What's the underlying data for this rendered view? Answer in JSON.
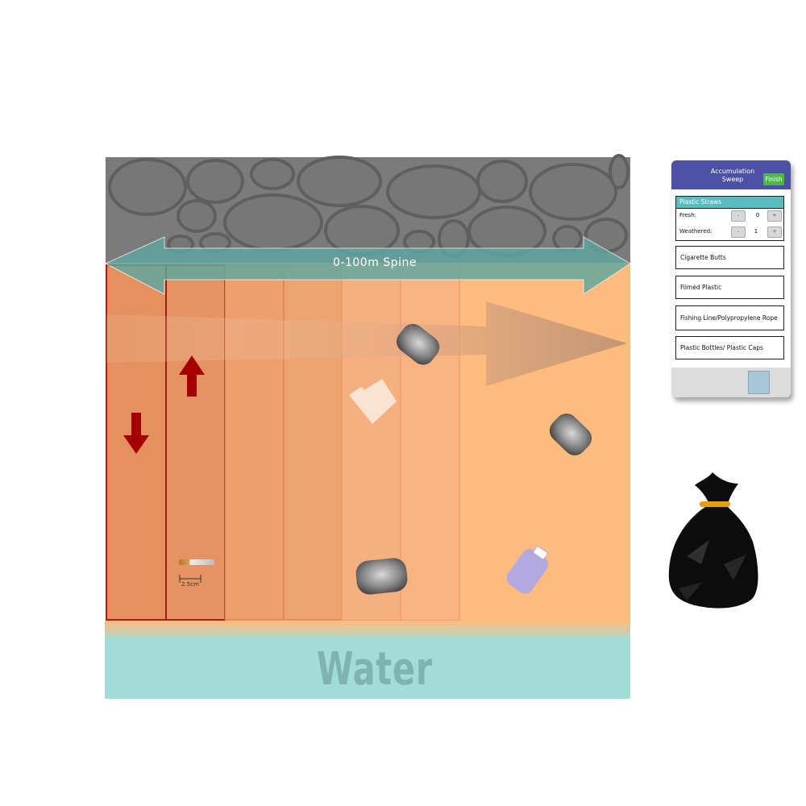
{
  "scene": {
    "spine_label": "0-100m Spine",
    "water_label": "Water",
    "scale_label": "2.5cm",
    "colors": {
      "sand": "#fdbb7d",
      "water": "#a2dcd9",
      "rocks": "#7b7b7b",
      "spine_arrow": "#5ea89f",
      "walk_arrow": "#a50000"
    }
  },
  "panel": {
    "title": "Accumulation Sweep",
    "finish_label": "Finish",
    "active_category": {
      "name": "Plastic Straws",
      "rows": [
        {
          "label": "Fresh:",
          "minus": "-",
          "value": "0",
          "plus": "+"
        },
        {
          "label": "Weathered:",
          "minus": "-",
          "value": "1",
          "plus": "+"
        }
      ]
    },
    "categories": [
      "Cigarette Butts",
      "Filmed Plastic",
      "Fishing Line/Polypropylene Rope",
      "Plastic Bottles/ Plastic Caps"
    ]
  },
  "icons": {
    "trash_bag": "trash-bag-icon",
    "cigarette": "cigarette-butt-icon",
    "bottle": "plastic-bottle-icon"
  }
}
